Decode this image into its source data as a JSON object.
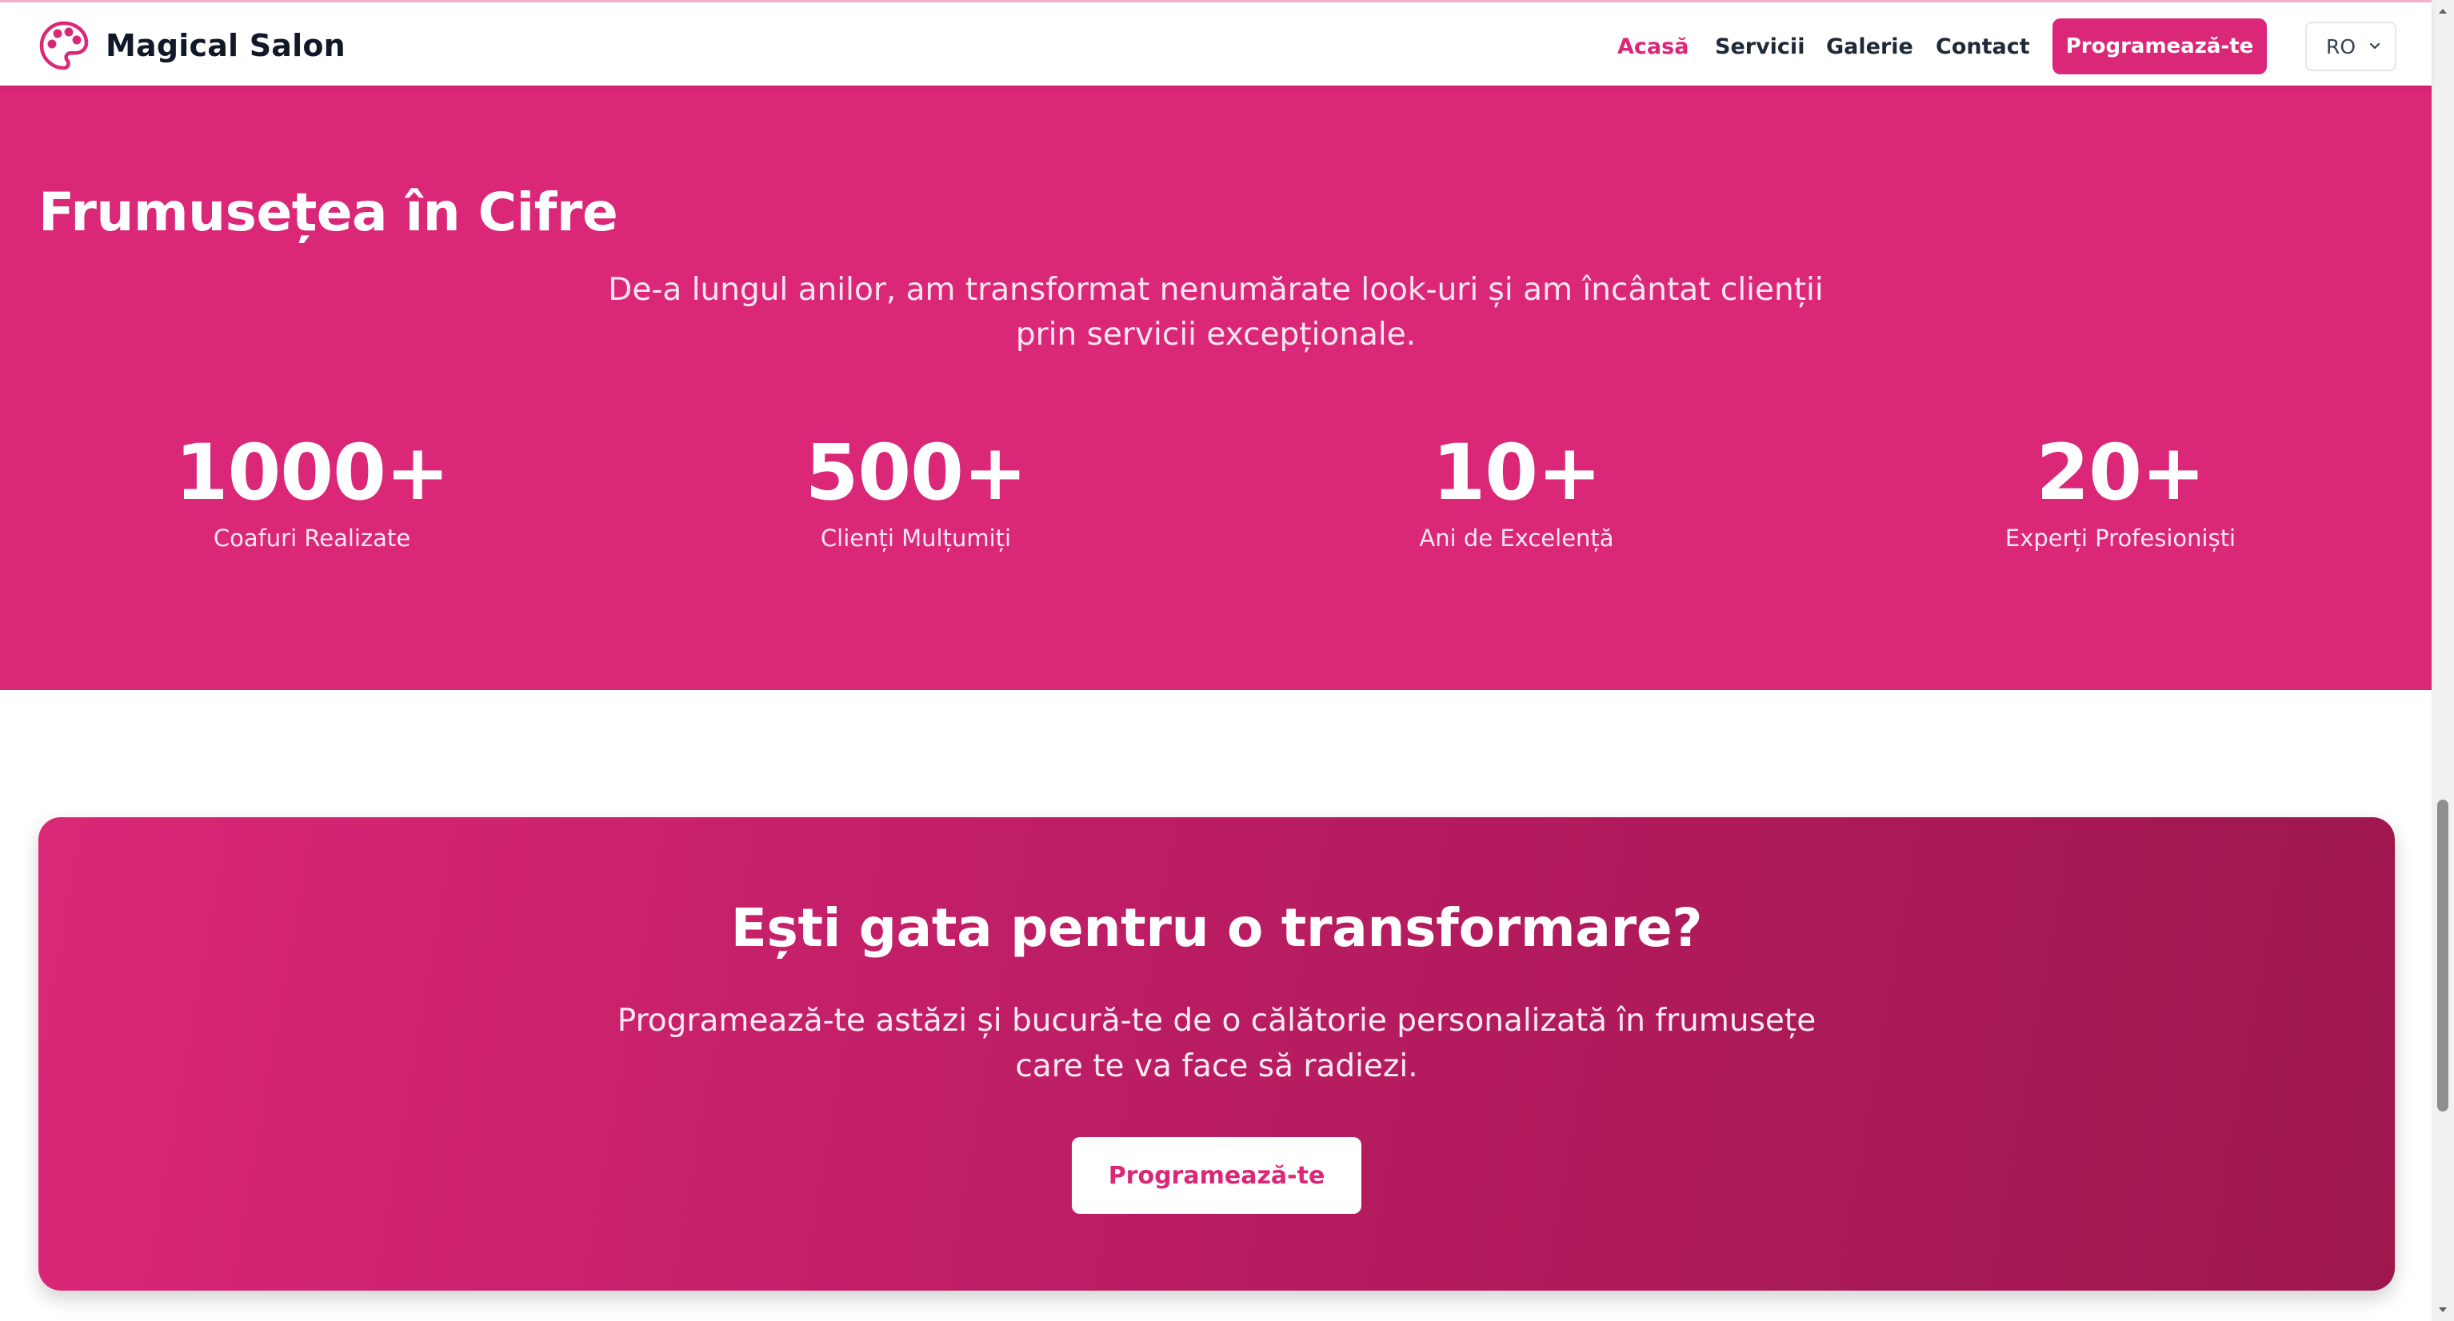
{
  "header": {
    "logo_icon": "palette-icon",
    "brand": "Magical Salon",
    "nav": [
      {
        "label": "Acasă",
        "active": true
      },
      {
        "label": "Servicii",
        "active": false
      },
      {
        "label": "Galerie",
        "active": false
      },
      {
        "label": "Contact",
        "active": false
      }
    ],
    "cta_label": "Programează-te",
    "language": {
      "selected": "RO",
      "icon": "chevron-down-icon"
    }
  },
  "stats": {
    "title": "Frumusețea în Cifre",
    "subtitle": "De-a lungul anilor, am transformat nenumărate look-uri și am încântat clienții prin servicii excepționale.",
    "items": [
      {
        "value": "1000+",
        "label": "Coafuri Realizate"
      },
      {
        "value": "500+",
        "label": "Clienți Mulțumiți"
      },
      {
        "value": "10+",
        "label": "Ani de Excelență"
      },
      {
        "value": "20+",
        "label": "Experți Profesioniști"
      }
    ]
  },
  "cta": {
    "title": "Ești gata pentru o transformare?",
    "text": "Programează-te astăzi și bucură-te de o călătorie personalizată în frumusețe care te va face să radiezi.",
    "button_label": "Programează-te"
  },
  "colors": {
    "accent": "#db2777",
    "gradient_end": "#9d174d",
    "text_dark": "#111827"
  }
}
